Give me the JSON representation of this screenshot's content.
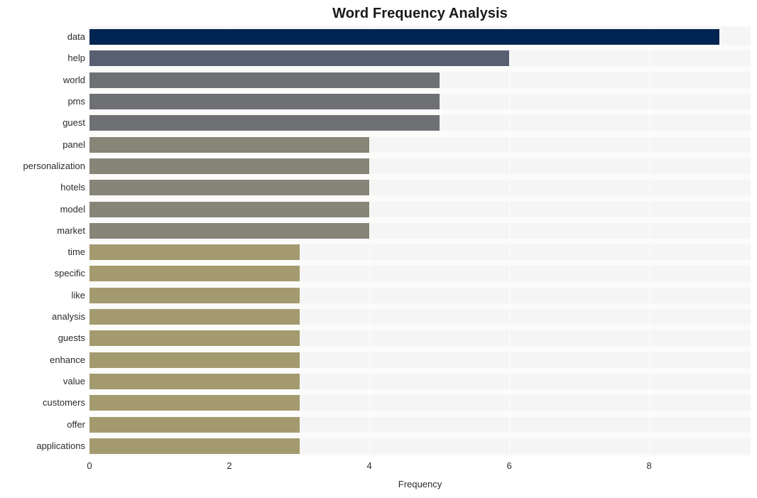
{
  "chart_data": {
    "type": "bar",
    "orientation": "horizontal",
    "title": "Word Frequency Analysis",
    "xlabel": "Frequency",
    "ylabel": "",
    "categories": [
      "data",
      "help",
      "world",
      "pms",
      "guest",
      "panel",
      "personalization",
      "hotels",
      "model",
      "market",
      "time",
      "specific",
      "like",
      "analysis",
      "guests",
      "enhance",
      "value",
      "customers",
      "offer",
      "applications"
    ],
    "values": [
      9,
      6,
      5,
      5,
      5,
      4,
      4,
      4,
      4,
      4,
      3,
      3,
      3,
      3,
      3,
      3,
      3,
      3,
      3,
      3
    ],
    "bar_colors": [
      "#002451",
      "#585f71",
      "#6e7073",
      "#6e7073",
      "#6e7073",
      "#878478",
      "#878478",
      "#878478",
      "#878478",
      "#878478",
      "#a39b6f",
      "#a39b6f",
      "#a39b6f",
      "#a39b6f",
      "#a39b6f",
      "#a39b6f",
      "#a39b6f",
      "#a39b6f",
      "#a39b6f",
      "#a39b6f"
    ],
    "xlim": [
      0,
      9.45
    ],
    "xticks": [
      0,
      2,
      4,
      6,
      8
    ],
    "xtick_labels": [
      "0",
      "2",
      "4",
      "6",
      "8"
    ],
    "grid": {
      "vertical": true,
      "horizontal": false,
      "color": "#ffffff"
    },
    "legend": null,
    "plot_background": "#f5f5f6",
    "figure_background": "#ffffff",
    "title_color": "#1a1a1a",
    "tick_label_color": "#2b2b2b"
  }
}
